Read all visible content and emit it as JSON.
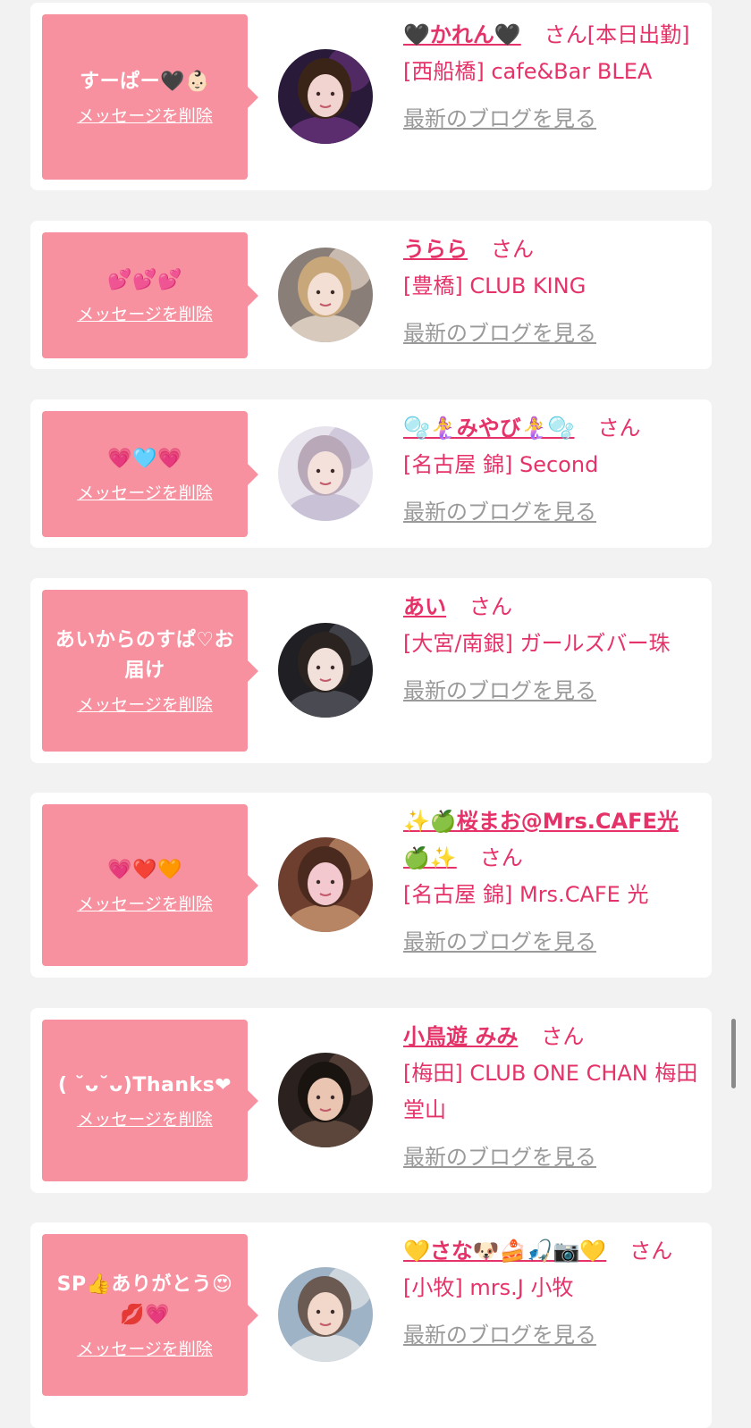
{
  "delete_label": "メッセージを削除",
  "blog_label": "最新のブログを見る",
  "san_label": "さん",
  "colors": {
    "background": "#f2f2f2",
    "bubble": "#f8919f",
    "name": "#e5336a",
    "link_gray": "#9a9a9a"
  },
  "cards": [
    {
      "message": "すーぱー🖤👶🏻",
      "name": "🖤かれん🖤",
      "san_suffix": "[本日出勤]",
      "shop": "[西船橋] cafe&Bar BLEA",
      "avatar_icon": "avatar-photo-karen"
    },
    {
      "message": "💕💕💕",
      "name": "うらら",
      "san_suffix": "",
      "shop": "[豊橋] CLUB KING",
      "avatar_icon": "avatar-photo-urara"
    },
    {
      "message": "💗🩵💗",
      "name": "🫧🧜‍♀️みやび🧜‍♀️🫧",
      "san_suffix": "",
      "shop": "[名古屋 錦] Second",
      "avatar_icon": "avatar-photo-miyabi"
    },
    {
      "message": "あいからのすぱ♡お届け",
      "name": "あい",
      "san_suffix": "",
      "shop": "[大宮/南銀] ガールズバー珠",
      "avatar_icon": "avatar-photo-ai"
    },
    {
      "message": "💗❤️🧡",
      "name": "✨🍏桜まお@Mrs.CAFE光🍏✨",
      "san_suffix": "",
      "shop": "[名古屋 錦] Mrs.CAFE 光",
      "avatar_icon": "avatar-photo-mao"
    },
    {
      "message": "( ˘ᴗ˘ᴗ)Thanks❤",
      "name": "小鳥遊 みみ",
      "san_suffix": "",
      "shop": "[梅田] CLUB ONE CHAN 梅田堂山",
      "avatar_icon": "avatar-photo-mimi"
    },
    {
      "message": "SP👍ありがとう😍💋💗",
      "name": "💛さな🐶🍰🎣📷💛",
      "san_suffix": "",
      "shop": "[小牧] mrs.J 小牧",
      "avatar_icon": "avatar-photo-sana"
    }
  ]
}
